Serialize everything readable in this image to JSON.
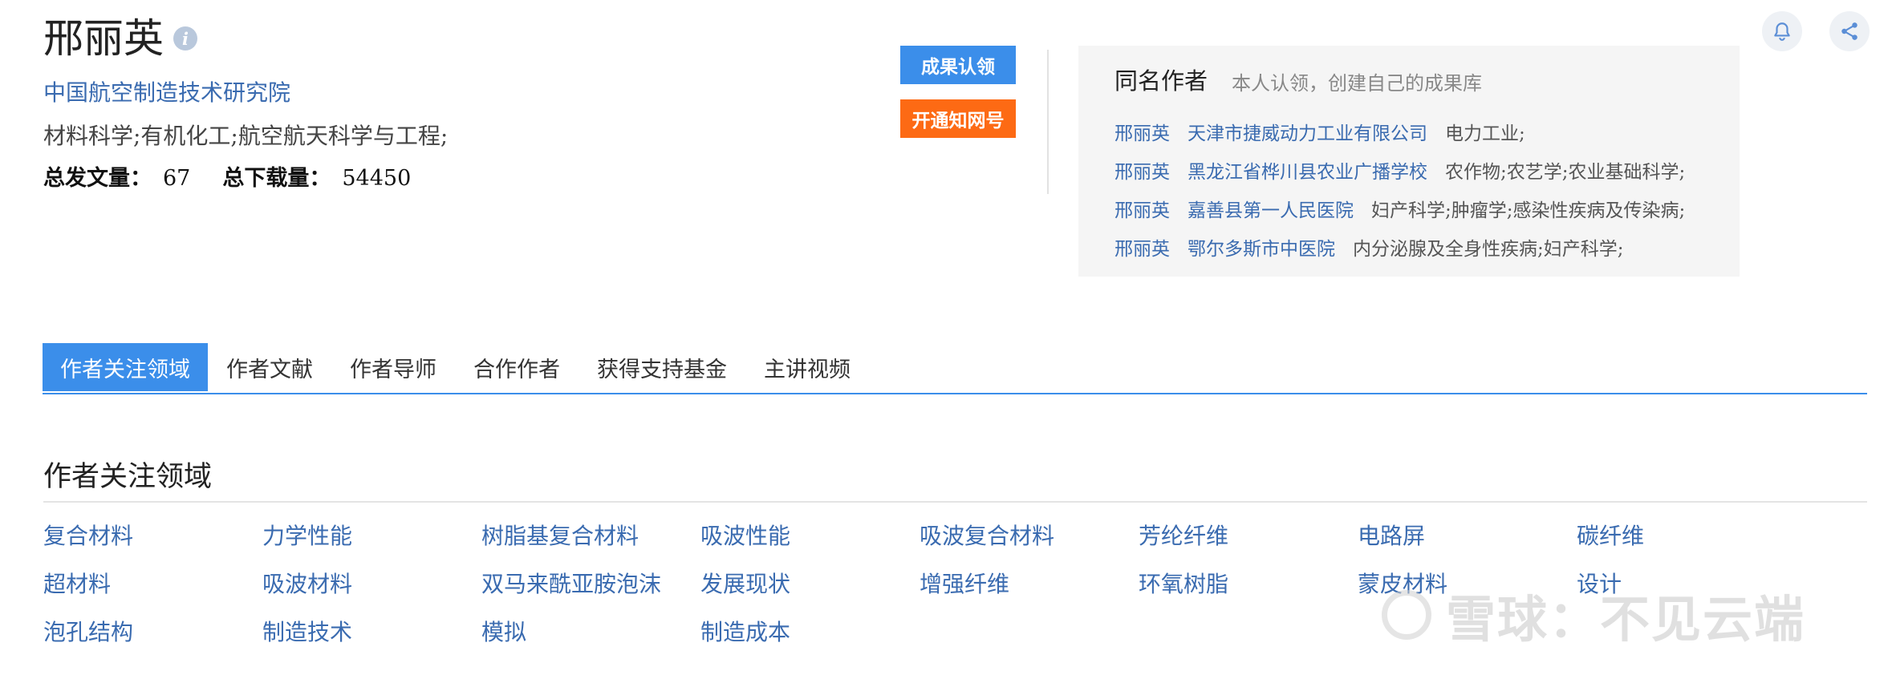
{
  "author": {
    "name": "邢丽英",
    "institution": "中国航空制造技术研究院",
    "fields": "材料科学;有机化工;航空航天科学与工程;",
    "stats": {
      "total_pubs_label": "总发文量：",
      "total_pubs": "67",
      "total_downloads_label": "总下载量：",
      "total_downloads": "54450"
    }
  },
  "actions": {
    "claim_label": "成果认领",
    "notify_label": "开通知网号"
  },
  "same_name": {
    "title": "同名作者",
    "subtitle": "本人认领，创建自己的成果库",
    "authors": [
      {
        "name": "邢丽英",
        "org": "天津市捷威动力工业有限公司",
        "fields": "电力工业;"
      },
      {
        "name": "邢丽英",
        "org": "黑龙江省桦川县农业广播学校",
        "fields": "农作物;农艺学;农业基础科学;"
      },
      {
        "name": "邢丽英",
        "org": "嘉善县第一人民医院",
        "fields": "妇产科学;肿瘤学;感染性疾病及传染病;"
      },
      {
        "name": "邢丽英",
        "org": "鄂尔多斯市中医院",
        "fields": "内分泌腺及全身性疾病;妇产科学;"
      }
    ]
  },
  "tabs": [
    "作者关注领域",
    "作者文献",
    "作者导师",
    "合作作者",
    "获得支持基金",
    "主讲视频"
  ],
  "active_tab": 0,
  "focus_section": {
    "title": "作者关注领域",
    "keywords": [
      [
        "复合材料",
        "力学性能",
        "树脂基复合材料",
        "吸波性能",
        "吸波复合材料",
        "芳纶纤维",
        "电路屏",
        "碳纤维"
      ],
      [
        "超材料",
        "吸波材料",
        "双马来酰亚胺泡沫",
        "发展现状",
        "增强纤维",
        "环氧树脂",
        "蒙皮材料",
        "设计"
      ],
      [
        "泡孔结构",
        "制造技术",
        "模拟",
        "制造成本"
      ]
    ]
  },
  "watermark": "雪球：不见云端",
  "icons": {
    "info": "info-icon",
    "bell": "bell-icon",
    "share": "share-icon",
    "watermark_logo": "xueqiu-logo-icon"
  },
  "colors": {
    "primary": "#3b8eea",
    "link": "#3a6bb0",
    "orange": "#fd6a14"
  }
}
